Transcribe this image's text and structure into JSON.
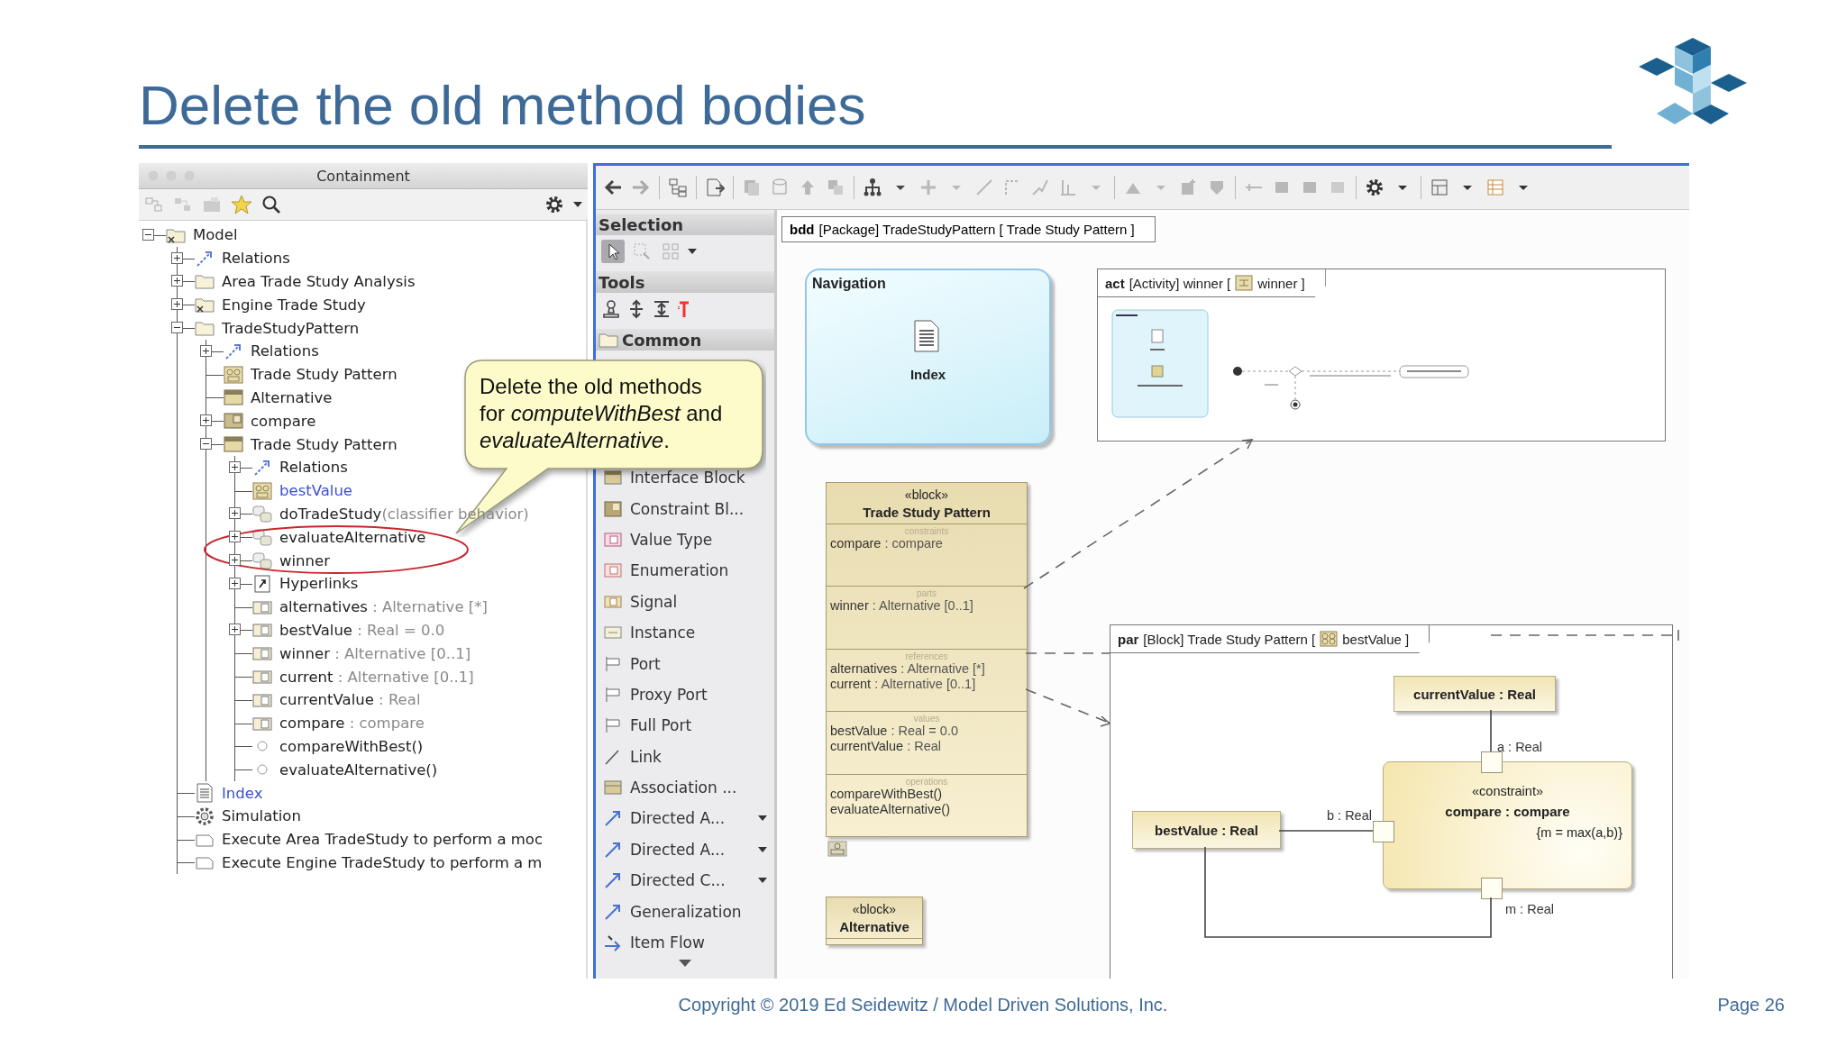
{
  "slide": {
    "title": "Delete the old method bodies",
    "copyright": "Copyright © 2019 Ed Seidewitz / Model Driven Solutions, Inc.",
    "page": "Page 26"
  },
  "containment": {
    "title": "Containment",
    "tree": [
      {
        "name": "Model",
        "kind": "model",
        "hyperlink": false,
        "expanded": true,
        "children": [
          {
            "name": "Relations",
            "kind": "relations",
            "hyperlink": false,
            "expanded": false
          },
          {
            "name": "Area Trade Study Analysis",
            "kind": "package",
            "hyperlink": false,
            "expanded": false
          },
          {
            "name": "Engine Trade Study",
            "kind": "model",
            "hyperlink": false,
            "expanded": false
          },
          {
            "name": "TradeStudyPattern",
            "kind": "package",
            "hyperlink": false,
            "expanded": true,
            "children": [
              {
                "name": "Relations",
                "kind": "relations",
                "hyperlink": false,
                "expanded": false
              },
              {
                "name": "Trade Study Pattern",
                "kind": "diagram",
                "hyperlink": false
              },
              {
                "name": "Alternative",
                "kind": "block",
                "hyperlink": false
              },
              {
                "name": "compare",
                "kind": "constraint",
                "hyperlink": false,
                "expanded": false
              },
              {
                "name": "Trade Study Pattern",
                "kind": "block",
                "hyperlink": false,
                "expanded": true,
                "children": [
                  {
                    "name": "Relations",
                    "kind": "relations",
                    "hyperlink": false,
                    "expanded": false
                  },
                  {
                    "name": "bestValue",
                    "kind": "diagram",
                    "hyperlink": true
                  },
                  {
                    "name": "doTradeStudy",
                    "detail": "(classifier behavior)",
                    "kind": "activity",
                    "hyperlink": false,
                    "expanded": false
                  },
                  {
                    "name": "evaluateAlternative",
                    "kind": "activity",
                    "hyperlink": false,
                    "expanded": false
                  },
                  {
                    "name": "winner",
                    "kind": "activity",
                    "hyperlink": false,
                    "expanded": false
                  },
                  {
                    "name": "Hyperlinks",
                    "kind": "hyperlinks",
                    "hyperlink": false,
                    "expanded": false
                  },
                  {
                    "name": "alternatives",
                    "detail": " : Alternative [*]",
                    "kind": "property",
                    "hyperlink": false
                  },
                  {
                    "name": "bestValue",
                    "detail": " : Real = 0.0",
                    "kind": "property",
                    "hyperlink": false,
                    "expanded": false
                  },
                  {
                    "name": "winner",
                    "detail": " : Alternative [0..1]",
                    "kind": "property",
                    "hyperlink": false
                  },
                  {
                    "name": "current",
                    "detail": " : Alternative [0..1]",
                    "kind": "property",
                    "hyperlink": false
                  },
                  {
                    "name": "currentValue",
                    "detail": " : Real",
                    "kind": "property",
                    "hyperlink": false
                  },
                  {
                    "name": "compare",
                    "detail": " : compare",
                    "kind": "property",
                    "hyperlink": false
                  },
                  {
                    "name": "compareWithBest()",
                    "kind": "operation",
                    "hyperlink": false
                  },
                  {
                    "name": "evaluateAlternative()",
                    "kind": "operation",
                    "hyperlink": false
                  }
                ]
              }
            ]
          },
          {
            "name": "Index",
            "kind": "document",
            "hyperlink": true
          },
          {
            "name": "Simulation",
            "kind": "simulation",
            "hyperlink": false
          },
          {
            "name": "Execute Area TradeStudy to perform a moc",
            "kind": "config",
            "hyperlink": false
          },
          {
            "name": "Execute Engine TradeStudy to perform a m",
            "kind": "config",
            "hyperlink": false
          }
        ]
      }
    ]
  },
  "palette": {
    "sections": [
      {
        "label": "Selection"
      },
      {
        "label": "Tools"
      },
      {
        "label": "Common"
      }
    ],
    "selection_tools": [
      {
        "kind": "pointer",
        "selected": true
      },
      {
        "kind": "marquee",
        "selected": false
      },
      {
        "kind": "grid",
        "selected": false
      }
    ],
    "items": [
      {
        "label": "Interface Block",
        "kind": "block",
        "has_menu": false
      },
      {
        "label": "Constraint Bl...",
        "kind": "constraint",
        "has_menu": false
      },
      {
        "label": "Value Type",
        "kind": "valuetype",
        "has_menu": false
      },
      {
        "label": "Enumeration",
        "kind": "enumeration",
        "has_menu": false
      },
      {
        "label": "Signal",
        "kind": "signal",
        "has_menu": false
      },
      {
        "label": "Instance",
        "kind": "instance",
        "has_menu": false
      },
      {
        "label": "Port",
        "kind": "port",
        "has_menu": false
      },
      {
        "label": "Proxy Port",
        "kind": "port",
        "has_menu": false
      },
      {
        "label": "Full Port",
        "kind": "port",
        "has_menu": false
      },
      {
        "label": "Link",
        "kind": "line",
        "has_menu": false
      },
      {
        "label": "Association ...",
        "kind": "association",
        "has_menu": false
      },
      {
        "label": "Directed A...",
        "kind": "arrow",
        "has_menu": true
      },
      {
        "label": "Directed A...",
        "kind": "arrow",
        "has_menu": true
      },
      {
        "label": "Directed C...",
        "kind": "arrow",
        "has_menu": true
      },
      {
        "label": "Generalization",
        "kind": "arrow",
        "has_menu": false
      },
      {
        "label": "Item Flow",
        "kind": "flow",
        "has_menu": false
      }
    ]
  },
  "diagram": {
    "header": {
      "keyword": "bdd",
      "text": "[Package] TradeStudyPattern [ Trade Study Pattern ]"
    },
    "navigation": {
      "title": "Navigation",
      "link": "Index"
    },
    "activity_frame": {
      "keyword": "act",
      "context": "[Activity] winner [",
      "name": "winner ]"
    },
    "block": {
      "stereotype": "«block»",
      "name": "Trade Study Pattern",
      "compartments": [
        {
          "label": "constraints",
          "lines": [
            {
              "name": "compare",
              "detail": " : compare"
            }
          ]
        },
        {
          "label": "parts",
          "lines": [
            {
              "name": "winner",
              "detail": " : Alternative [0..1]"
            }
          ]
        },
        {
          "label": "references",
          "lines": [
            {
              "name": "alternatives",
              "detail": " : Alternative [*]"
            },
            {
              "name": "current",
              "detail": " : Alternative [0..1]"
            }
          ]
        },
        {
          "label": "values",
          "lines": [
            {
              "name": "bestValue",
              "detail": " : Real = 0.0"
            },
            {
              "name": "currentValue",
              "detail": " : Real"
            }
          ]
        },
        {
          "label": "operations",
          "lines": [
            {
              "name": "compareWithBest()"
            },
            {
              "name": "evaluateAlternative()"
            }
          ]
        }
      ]
    },
    "alternative": {
      "stereotype": "«block»",
      "name": "Alternative"
    },
    "parametric": {
      "keyword": "par",
      "context": "[Block] Trade Study Pattern [",
      "name": "bestValue ]",
      "parts": [
        {
          "label": "currentValue : Real"
        },
        {
          "label": "bestValue : Real"
        }
      ],
      "constraint": {
        "stereotype": "«constraint»",
        "name": "compare : compare",
        "expression": "{m = max(a,b)}"
      },
      "ports": [
        {
          "label": "a : Real"
        },
        {
          "label": "b : Real"
        },
        {
          "label": "m : Real"
        }
      ]
    }
  },
  "callout": {
    "text": "Delete the old methods for *computeWithBest* and *evaluateAlternative*."
  }
}
